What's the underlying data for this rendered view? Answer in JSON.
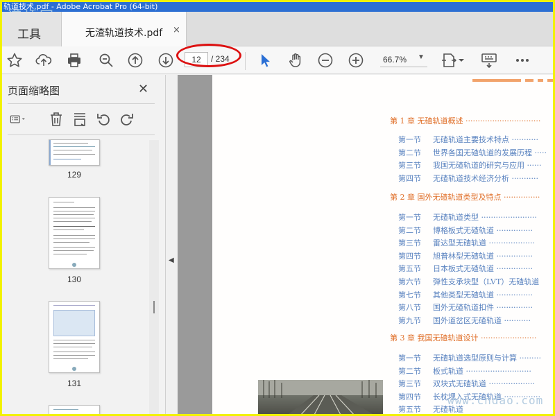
{
  "window": {
    "title": "轨道技术.pdf - Adobe Acrobat Pro (64-bit)",
    "watermark_top": "道桥网",
    "watermark_bottom": "www.cndao.com"
  },
  "tabs": {
    "tools_label": "工具",
    "doc_label": "无渣轨道技术.pdf",
    "close_glyph": "×"
  },
  "toolbar": {
    "page_current": "12",
    "page_total": "/ 234",
    "zoom_value": "66.7%",
    "icons": [
      "star-icon",
      "upload-icon",
      "print-icon",
      "zoom-out-search-icon",
      "page-up-icon",
      "page-down-icon",
      "select-cursor-icon",
      "hand-icon",
      "zoom-out-icon",
      "zoom-in-icon",
      "page-display-icon",
      "comment-icon",
      "more-icon"
    ]
  },
  "sidebar": {
    "title": "页面缩略图",
    "thumbs": [
      {
        "number": "129"
      },
      {
        "number": "130"
      },
      {
        "number": "131"
      }
    ]
  },
  "document": {
    "chapters": [
      {
        "label": "第 1 章    无碴轨道概述 ·······························",
        "sections": [
          {
            "num": "第一节",
            "title": "无碴轨道主要技术特点 ···········"
          },
          {
            "num": "第二节",
            "title": "世界各国无碴轨道的发展历程 ·····"
          },
          {
            "num": "第三节",
            "title": "我国无碴轨道的研究与应用 ······"
          },
          {
            "num": "第四节",
            "title": "无碴轨道技术经济分析 ···········"
          }
        ]
      },
      {
        "label": "第 2 章    国外无碴轨道类型及特点 ···············",
        "sections": [
          {
            "num": "第一节",
            "title": "无碴轨道类型 ·······················"
          },
          {
            "num": "第二节",
            "title": "博格板式无碴轨道 ···············"
          },
          {
            "num": "第三节",
            "title": "雷达型无碴轨道 ···················"
          },
          {
            "num": "第四节",
            "title": "旭普林型无碴轨道 ···············"
          },
          {
            "num": "第五节",
            "title": "日本板式无碴轨道 ···············"
          },
          {
            "num": "第六节",
            "title": "弹性支承块型（LVT）无碴轨道"
          },
          {
            "num": "第七节",
            "title": "其他类型无碴轨道 ···············"
          },
          {
            "num": "第八节",
            "title": "国外无碴轨道扣件 ···············"
          },
          {
            "num": "第九节",
            "title": "国外道岔区无碴轨道 ···········"
          }
        ]
      },
      {
        "label": "第 3 章    我国无碴轨道设计 ·······················",
        "sections": [
          {
            "num": "第一节",
            "title": "无碴轨道选型原则与计算 ·········"
          },
          {
            "num": "第二节",
            "title": "板式轨道 ···························"
          },
          {
            "num": "第三节",
            "title": "双块式无碴轨道 ···················"
          },
          {
            "num": "第四节",
            "title": "长枕埋入式无碴轨道 ···············"
          },
          {
            "num": "第五节",
            "title": "无碴轨道"
          }
        ]
      }
    ]
  },
  "colors": {
    "chapter": "#e0702a",
    "section": "#5a83c0",
    "highlight_ellipse": "#dd1111",
    "titlebar": "#2c6fd3",
    "frame": "#f2f200"
  }
}
